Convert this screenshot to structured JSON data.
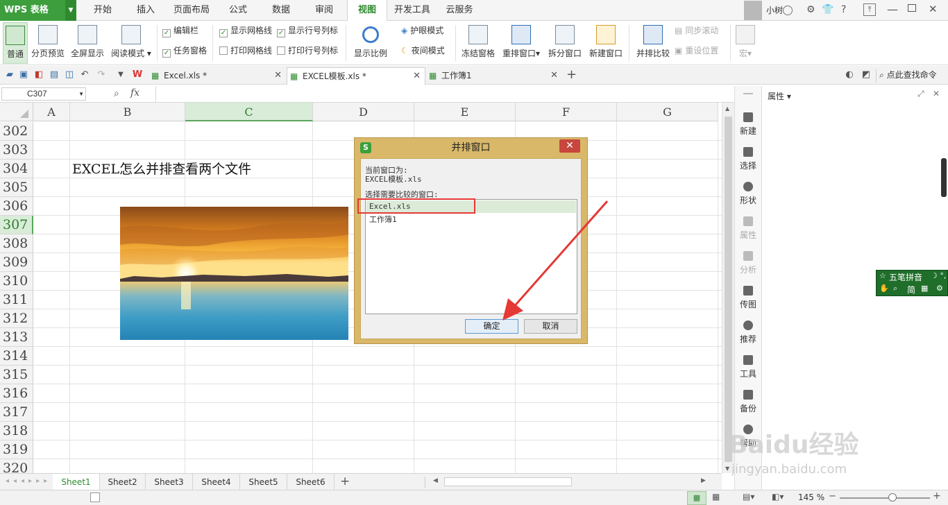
{
  "app": {
    "logo_label": "WPS 表格"
  },
  "menu": {
    "items": [
      "开始",
      "插入",
      "页面布局",
      "公式",
      "数据",
      "审阅",
      "视图",
      "开发工具",
      "云服务"
    ],
    "active": "视图"
  },
  "user": {
    "name": "小树",
    "help": "?"
  },
  "ribbon": {
    "normal": "普通",
    "page_break": "分页预览",
    "fullscreen": "全屏显示",
    "reading": "阅读模式",
    "edit_bar": "编辑栏",
    "task_pane": "任务窗格",
    "show_gridlines": "显示网格线",
    "print_gridlines": "打印网格线",
    "show_headers": "显示行号列标",
    "print_headers": "打印行号列标",
    "zoom": "显示比例",
    "eye_protect": "护眼模式",
    "night": "夜间模式",
    "freeze": "冻结窗格",
    "arrange": "重排窗口",
    "split": "拆分窗口",
    "new_window": "新建窗口",
    "side_by_side": "并排比较",
    "sync_scroll": "同步滚动",
    "reset_pos": "重设位置",
    "macro": "宏"
  },
  "tabs": [
    {
      "label": "Excel.xls *"
    },
    {
      "label": "EXCEL模板.xls *"
    },
    {
      "label": "工作簿1"
    }
  ],
  "search_cmd": "点此查找命令",
  "formula_bar": {
    "cell_ref": "C307",
    "fx": "fx",
    "value": ""
  },
  "columns": [
    "A",
    "B",
    "C",
    "D",
    "E",
    "F",
    "G"
  ],
  "rows": [
    "302",
    "303",
    "304",
    "305",
    "306",
    "307",
    "308",
    "309",
    "310",
    "311",
    "312",
    "313",
    "314",
    "315",
    "316",
    "317",
    "318",
    "319",
    "320"
  ],
  "selected_row": "307",
  "selected_col": "C",
  "cell_text": "EXCEL怎么并排查看两个文件",
  "dialog": {
    "title": "并排窗口",
    "current_label": "当前窗口为:",
    "current_file": "EXCEL模板.xls",
    "select_label": "选择需要比较的窗口:",
    "options": [
      "Excel.xls",
      "工作簿1"
    ],
    "ok": "确定",
    "cancel": "取消"
  },
  "sidebar": [
    "新建",
    "选择",
    "形状",
    "属性",
    "分析",
    "传图",
    "推荐",
    "工具",
    "备份",
    "帮助"
  ],
  "props_title": "属性",
  "ime": {
    "name": "五笔拼音",
    "mode": "简"
  },
  "sheets": [
    "Sheet1",
    "Sheet2",
    "Sheet3",
    "Sheet4",
    "Sheet5",
    "Sheet6"
  ],
  "active_sheet": "Sheet1",
  "zoom": "145 %",
  "watermark": {
    "brand": "Baidu经验",
    "url": "jingyan.baidu.com"
  }
}
